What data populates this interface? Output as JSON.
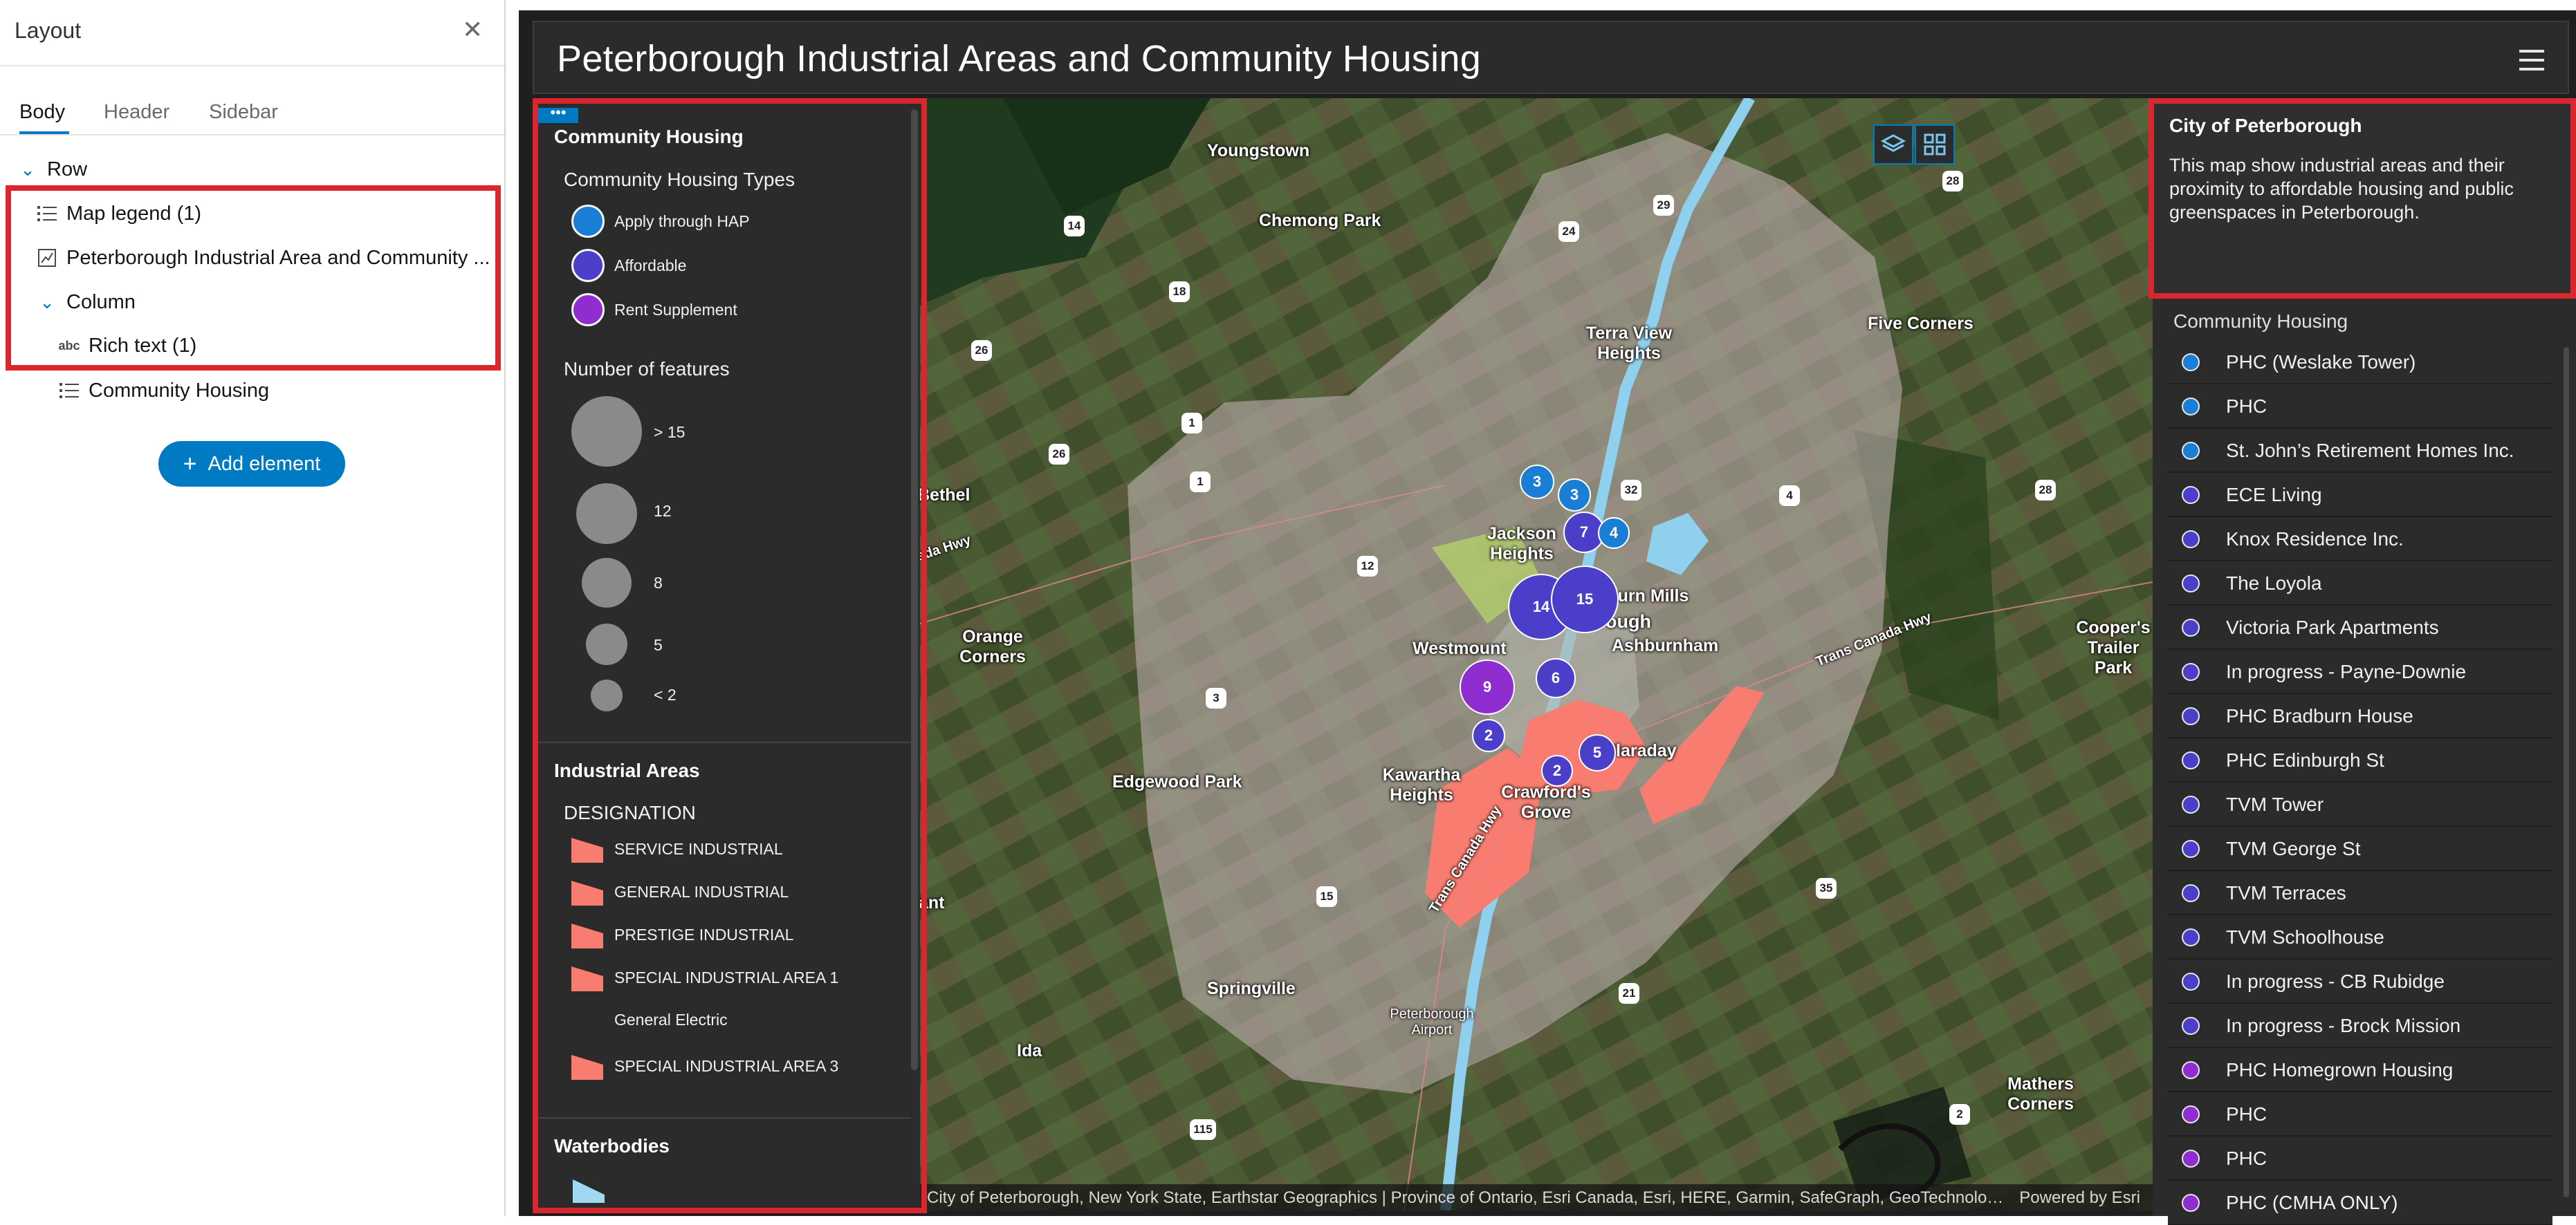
{
  "layout_panel": {
    "title": "Layout",
    "close_icon": "close-icon",
    "tabs": [
      {
        "label": "Body",
        "active": true
      },
      {
        "label": "Header",
        "active": false
      },
      {
        "label": "Sidebar",
        "active": false
      }
    ],
    "tree": [
      {
        "label": "Row",
        "icon": "chevron-down-icon",
        "level": 0
      },
      {
        "label": "Map legend (1)",
        "icon": "list-icon",
        "level": 1
      },
      {
        "label": "Peterborough Industrial Area and Community ...",
        "icon": "map-icon",
        "level": 1
      },
      {
        "label": "Column",
        "icon": "chevron-down-icon",
        "level": 1
      },
      {
        "label": "Rich text (1)",
        "icon": "text-icon",
        "level": 2
      },
      {
        "label": "Community Housing",
        "icon": "list-icon",
        "level": 1
      }
    ],
    "add_button": "Add element"
  },
  "app": {
    "title": "Peterborough Industrial Areas and Community Housing",
    "legend": {
      "menu": "•••",
      "community_housing": {
        "title": "Community Housing",
        "types_title": "Community Housing Types",
        "types": [
          {
            "label": "Apply through HAP",
            "color": "#1a7ed6"
          },
          {
            "label": "Affordable",
            "color": "#4b3fc9"
          },
          {
            "label": "Rent Supplement",
            "color": "#8f2dd1"
          }
        ],
        "size_title": "Number of features",
        "sizes": [
          "> 15",
          "12",
          "8",
          "5",
          "< 2"
        ]
      },
      "industrial": {
        "title": "Industrial Areas",
        "designation_title": "DESIGNATION",
        "items": [
          "SERVICE INDUSTRIAL",
          "GENERAL INDUSTRIAL",
          "PRESTIGE INDUSTRIAL",
          "SPECIAL INDUSTRIAL AREA 1",
          "General Electric",
          "SPECIAL INDUSTRIAL AREA 3"
        ],
        "color": "#f97c70"
      },
      "waterbodies": {
        "title": "Waterbodies"
      }
    },
    "map": {
      "place_labels": [
        "Youngstown",
        "Chemong Park",
        "Terra View Heights",
        "Five Corners",
        "Bethel",
        "Jackson Heights",
        "Auburn Mills",
        "Peterborough",
        "Ashburnham",
        "Orange Corners",
        "Westmount",
        "Cooper's Trailer Park",
        "Kawartha Heights",
        "Crawford's Grove",
        "Claraday",
        "Edgewood Park",
        "Springville",
        "Peterborough Airport",
        "Ida",
        "Mathers Corners",
        "ant",
        "Trans Canada Hwy",
        "ada Hwy"
      ],
      "road_shields": [
        "14",
        "24",
        "29",
        "28",
        "18",
        "26",
        "26",
        "1",
        "1",
        "12",
        "32",
        "4",
        "28",
        "3",
        "15",
        "21",
        "35",
        "115",
        "2"
      ],
      "clusters": [
        {
          "label": "3",
          "type": "hap"
        },
        {
          "label": "3",
          "type": "hap"
        },
        {
          "label": "7",
          "type": "aff"
        },
        {
          "label": "4",
          "type": "hap"
        },
        {
          "label": "14",
          "type": "aff"
        },
        {
          "label": "15",
          "type": "aff"
        },
        {
          "label": "9",
          "type": "rent"
        },
        {
          "label": "6",
          "type": "aff"
        },
        {
          "label": "2",
          "type": "aff"
        },
        {
          "label": "2",
          "type": "aff"
        },
        {
          "label": "5",
          "type": "aff"
        }
      ],
      "attribution": "City of Peterborough, New York State, Earthstar Geographics | Province of Ontario, Esri Canada, Esri, HERE, Garmin, SafeGraph, GeoTechnolo…",
      "powered_by": "Powered by Esri",
      "layers_button_icon": "layers-icon",
      "basemap_button_icon": "qr-grid-icon"
    },
    "city_box": {
      "title": "City of Peterborough",
      "text": "This map show industrial areas and their proximity to affordable housing and public greenspaces in Peterborough."
    },
    "community_housing_list": {
      "title": "Community Housing",
      "items": [
        {
          "label": "PHC (Weslake Tower)",
          "color": "#1a7ed6"
        },
        {
          "label": "PHC",
          "color": "#1a7ed6"
        },
        {
          "label": "St. John’s Retirement Homes Inc.",
          "color": "#1a7ed6"
        },
        {
          "label": "ECE Living",
          "color": "#4b3fc9"
        },
        {
          "label": "Knox Residence Inc.",
          "color": "#4b3fc9"
        },
        {
          "label": "The Loyola",
          "color": "#4b3fc9"
        },
        {
          "label": "Victoria Park Apartments",
          "color": "#4b3fc9"
        },
        {
          "label": "In progress - Payne-Downie",
          "color": "#4b3fc9"
        },
        {
          "label": "PHC Bradburn House",
          "color": "#4b3fc9"
        },
        {
          "label": "PHC Edinburgh St",
          "color": "#4b3fc9"
        },
        {
          "label": "TVM Tower",
          "color": "#4b3fc9"
        },
        {
          "label": "TVM George St",
          "color": "#4b3fc9"
        },
        {
          "label": "TVM Terraces",
          "color": "#4b3fc9"
        },
        {
          "label": "TVM Schoolhouse",
          "color": "#4b3fc9"
        },
        {
          "label": "In progress - CB Rubidge",
          "color": "#4b3fc9"
        },
        {
          "label": "In progress - Brock Mission",
          "color": "#4b3fc9"
        },
        {
          "label": "PHC Homegrown Housing",
          "color": "#8f2dd1"
        },
        {
          "label": "PHC",
          "color": "#8f2dd1"
        },
        {
          "label": "PHC",
          "color": "#8f2dd1"
        },
        {
          "label": "PHC (CMHA ONLY)",
          "color": "#8f2dd1"
        }
      ]
    }
  },
  "colors": {
    "accent": "#007ac2",
    "highlight_box": "#d9262f",
    "industrial": "#f97c70"
  }
}
